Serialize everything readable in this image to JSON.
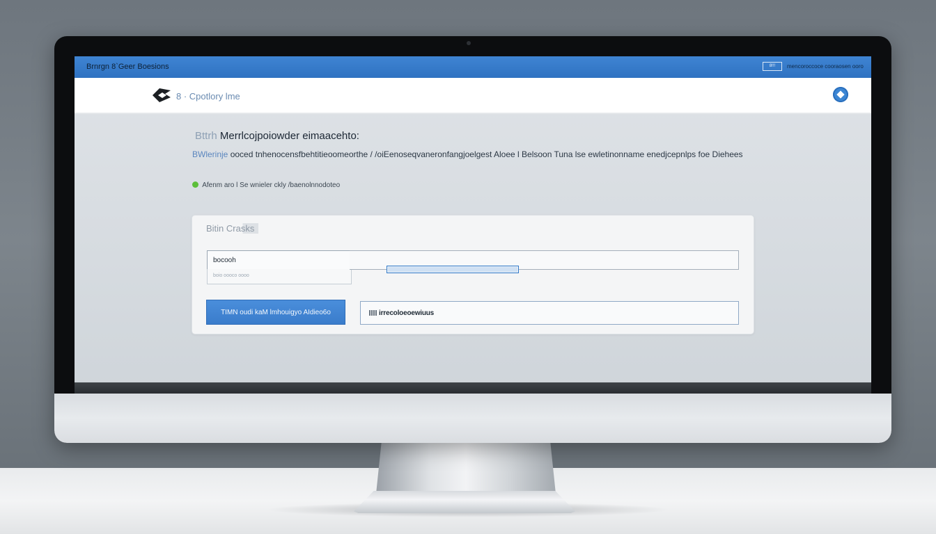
{
  "window": {
    "title": "Brnrgn 8`Geer Boesions",
    "top_badge": "8!!!",
    "top_link": "mencoroccoce cooraosen ooro"
  },
  "header": {
    "title": "8 · Cpotlory lme",
    "logo_icon": "brand-logo-icon",
    "right_icon": "blue-circle-diamond-icon"
  },
  "content": {
    "heading_prefix": "Bttrh",
    "heading": "Merrlcojpoiowder eimaacehto:",
    "description_prefix": "BWlerinje",
    "description": "ooced   tnhenocensfbehtitieoomeorthe / /oiEenoseqvaneronfangjoelgest Aloee  l Belsoon Tuna  lse ewletinonname enedjcepnlps foe Diehees",
    "status_text": "Afenm aro   l   Se wnieler ckly /baenolnnodoteo",
    "status_color": "#5cbf3a"
  },
  "card": {
    "title": "Bitin Crasks",
    "field_label": "bocooh",
    "field_sub": "boio oooco oooo",
    "progress": 1.0,
    "submit_label": "TIMN oudi  kaM  lmhouigyo   AIdieo6o",
    "status_field_text": "irrecoloeoewiuus"
  },
  "colors": {
    "accent": "#3a7ccb",
    "topbar": "#3379c7",
    "status_green": "#5cbf3a"
  }
}
